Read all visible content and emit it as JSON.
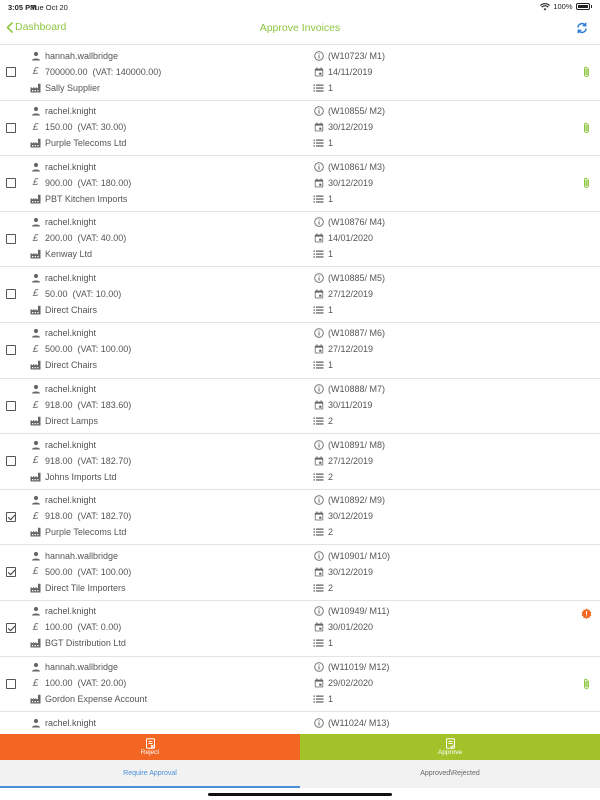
{
  "status_bar": {
    "time": "3:05 PM",
    "date": "Tue Oct 20",
    "battery": "100%"
  },
  "nav": {
    "back_label": "Dashboard",
    "title": "Approve Invoices"
  },
  "colors": {
    "accent": "#8dc63f",
    "reject": "#f26522",
    "approve": "#a3c22a",
    "tab_active": "#4a90d9"
  },
  "invoices": [
    {
      "user": "hannah.wallbridge",
      "amount": "700000.00  (VAT: 140000.00)",
      "supplier": "Sally Supplier",
      "ref": "(W10723/ M1)",
      "date": "14/11/2019",
      "lines": "1",
      "checked": false,
      "status_icon": "attachment-icon"
    },
    {
      "user": "rachel.knight",
      "amount": "150.00  (VAT: 30.00)",
      "supplier": "Purple Telecoms Ltd",
      "ref": "(W10855/ M2)",
      "date": "30/12/2019",
      "lines": "1",
      "checked": false,
      "status_icon": "attachment-icon"
    },
    {
      "user": "rachel.knight",
      "amount": "900.00  (VAT: 180.00)",
      "supplier": "PBT Kitchen Imports",
      "ref": "(W10861/ M3)",
      "date": "30/12/2019",
      "lines": "1",
      "checked": false,
      "status_icon": "attachment-icon"
    },
    {
      "user": "rachel.knight",
      "amount": "200.00  (VAT: 40.00)",
      "supplier": "Kenway Ltd",
      "ref": "(W10876/ M4)",
      "date": "14/01/2020",
      "lines": "1",
      "checked": false,
      "status_icon": ""
    },
    {
      "user": "rachel.knight",
      "amount": "50.00  (VAT: 10.00)",
      "supplier": "Direct Chairs",
      "ref": "(W10885/ M5)",
      "date": "27/12/2019",
      "lines": "1",
      "checked": false,
      "status_icon": ""
    },
    {
      "user": "rachel.knight",
      "amount": "500.00  (VAT: 100.00)",
      "supplier": "Direct Chairs",
      "ref": "(W10887/ M6)",
      "date": "27/12/2019",
      "lines": "1",
      "checked": false,
      "status_icon": ""
    },
    {
      "user": "rachel.knight",
      "amount": "918.00  (VAT: 183.60)",
      "supplier": "Direct Lamps",
      "ref": "(W10888/ M7)",
      "date": "30/11/2019",
      "lines": "2",
      "checked": false,
      "status_icon": ""
    },
    {
      "user": "rachel.knight",
      "amount": "918.00  (VAT: 182.70)",
      "supplier": "Johns Imports Ltd",
      "ref": "(W10891/ M8)",
      "date": "27/12/2019",
      "lines": "2",
      "checked": false,
      "status_icon": ""
    },
    {
      "user": "rachel.knight",
      "amount": "918.00  (VAT: 182.70)",
      "supplier": "Purple Telecoms Ltd",
      "ref": "(W10892/ M9)",
      "date": "30/12/2019",
      "lines": "2",
      "checked": true,
      "status_icon": ""
    },
    {
      "user": "hannah.wallbridge",
      "amount": "500.00  (VAT: 100.00)",
      "supplier": "Direct Tile Importers",
      "ref": "(W10901/ M10)",
      "date": "30/12/2019",
      "lines": "2",
      "checked": true,
      "status_icon": ""
    },
    {
      "user": "rachel.knight",
      "amount": "100.00  (VAT: 0.00)",
      "supplier": "BGT Distribution Ltd",
      "ref": "(W10949/ M11)",
      "date": "30/01/2020",
      "lines": "1",
      "checked": true,
      "status_icon": "alert-icon"
    },
    {
      "user": "hannah.wallbridge",
      "amount": "100.00  (VAT: 20.00)",
      "supplier": "Gordon Expense Account",
      "ref": "(W11019/ M12)",
      "date": "29/02/2020",
      "lines": "1",
      "checked": false,
      "status_icon": "attachment-icon"
    },
    {
      "user": "rachel.knight",
      "amount": "",
      "supplier": "",
      "ref": "(W11024/ M13)",
      "date": "",
      "lines": "",
      "checked": false,
      "status_icon": ""
    }
  ],
  "actions": {
    "reject_label": "Reject",
    "approve_label": "Approve"
  },
  "tabs": [
    {
      "label": "Require Approval",
      "active": true
    },
    {
      "label": "Approved\\Rejected",
      "active": false
    }
  ]
}
